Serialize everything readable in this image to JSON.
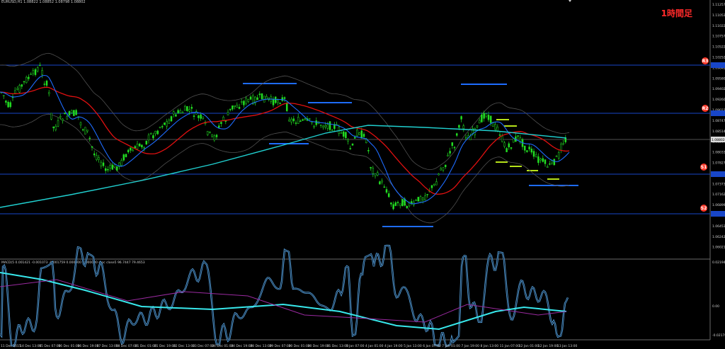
{
  "header": {
    "symbol_line": "EURUSD,H1  1.08822 1.08852 1.08798 1.08802",
    "timeframe_label": "1時間足"
  },
  "indicator": {
    "header": "MACD(5 0.001421 -0.001073 -0.001759 0.000000 0.000000  stoc close5 96.7447 79.4653"
  },
  "price_axis": {
    "ticks": [
      "1.11257",
      "1.11053",
      "1.11022",
      "1.10757",
      "1.10522",
      "1.10252",
      "1.09842",
      "1.09580",
      "1.09402",
      "1.09260",
      "1.09023",
      "1.08747",
      "1.08514",
      "1.08307",
      "1.08033",
      "1.07827",
      "1.07612",
      "1.07373",
      "1.07162",
      "1.06899",
      "1.06687",
      "1.06453",
      "1.06242",
      "1.06021"
    ],
    "current_price": "1.08802"
  },
  "indicator_axis": {
    "ticks": [
      "0.021945",
      "0.00",
      "-0.021789"
    ]
  },
  "time_axis": {
    "ticks": [
      "11 Dec 2015",
      "14 Dec 13:00",
      "15 Dec 07:00",
      "16 Dec 01:00",
      "16 Dec 19:00",
      "17 Dec 13:00",
      "18 Dec 07:00",
      "21 Dec 01:00",
      "21 Dec 19:00",
      "22 Dec 13:00",
      "23 Dec 07:00",
      "24 Dec 01:00",
      "24 Dec 19:00",
      "28 Dec 13:00",
      "29 Dec 07:00",
      "30 Dec 01:00",
      "30 Dec 19:00",
      "31 Dec 13:00",
      "1 Jan 07:00",
      "4 Jan 01:00",
      "4 Jan 19:00",
      "5 Jan 13:00",
      "6 Jan 07:00",
      "7 Jan 01:00",
      "7 Jan 19:00",
      "8 Jan 13:00",
      "11 Jan 07:00",
      "12 Jan 01:00",
      "12 Jan 19:00",
      "13 Jan 13:00"
    ]
  },
  "level_markers": [
    "R3",
    "R2",
    "S1",
    "S2"
  ],
  "colors": {
    "candle": "#22dd22",
    "ma_red": "#e01010",
    "ma_blue": "#1e6cff",
    "ma_cyan": "#20d0d0",
    "bands": "#505050",
    "level_line": "#1846c8",
    "marker": "#ff3a2a"
  }
}
